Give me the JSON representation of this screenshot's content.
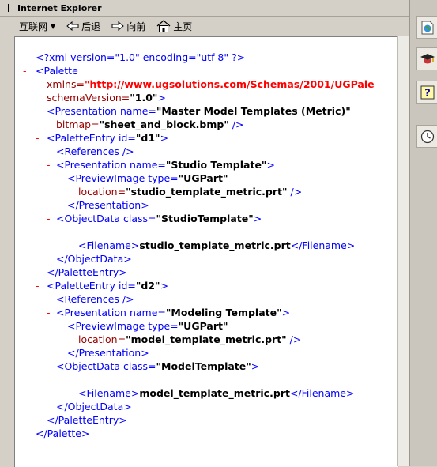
{
  "window": {
    "title": "Internet Explorer"
  },
  "toolbar": {
    "menu_label": "互联网",
    "back_label": "后退",
    "forward_label": "向前",
    "home_label": "主页"
  },
  "xml": {
    "decl": "<?xml version=\"1.0\" encoding=\"utf-8\" ?>",
    "minus": "-",
    "palette_tag": "<Palette",
    "xmlns_attr": "xmlns=",
    "xmlns_value": "\"http://www.ugsolutions.com/Schemas/2001/UGPale",
    "schema_attr": "schemaVersion=",
    "schema_value": "\"1.0\"",
    "schema_end": ">",
    "pres_open": "<Presentation name=",
    "pres_name": "\"Master Model Templates (Metric)\"",
    "bitmap_attr": "bitmap=",
    "bitmap_value": "\"sheet_and_block.bmp\"",
    "selfclose": " />",
    "entry1_open": "<PaletteEntry id=",
    "entry1_id": "\"d1\"",
    "gt": ">",
    "refs": "<References />",
    "pres1_open": "<Presentation name=",
    "pres1_name": "\"Studio Template\"",
    "preview_open": "<PreviewImage type=",
    "preview_type": "\"UGPart\"",
    "location_attr": "location=",
    "loc1": "\"studio_template_metric.prt\"",
    "pres_close": "</Presentation>",
    "obj_open": "<ObjectData class=",
    "obj1_class": "\"StudioTemplate\"",
    "filename_open": "<Filename>",
    "filename1": "studio_template_metric.prt",
    "filename_close": "</Filename>",
    "obj_close": "</ObjectData>",
    "entry_close": "</PaletteEntry>",
    "entry2_open": "<PaletteEntry id=",
    "entry2_id": "\"d2\"",
    "pres2_name": "\"Modeling Template\"",
    "loc2": "\"model_template_metric.prt\"",
    "obj2_class": "\"ModelTemplate\"",
    "filename2": "model_template_metric.prt",
    "palette_close": "</Palette>"
  }
}
